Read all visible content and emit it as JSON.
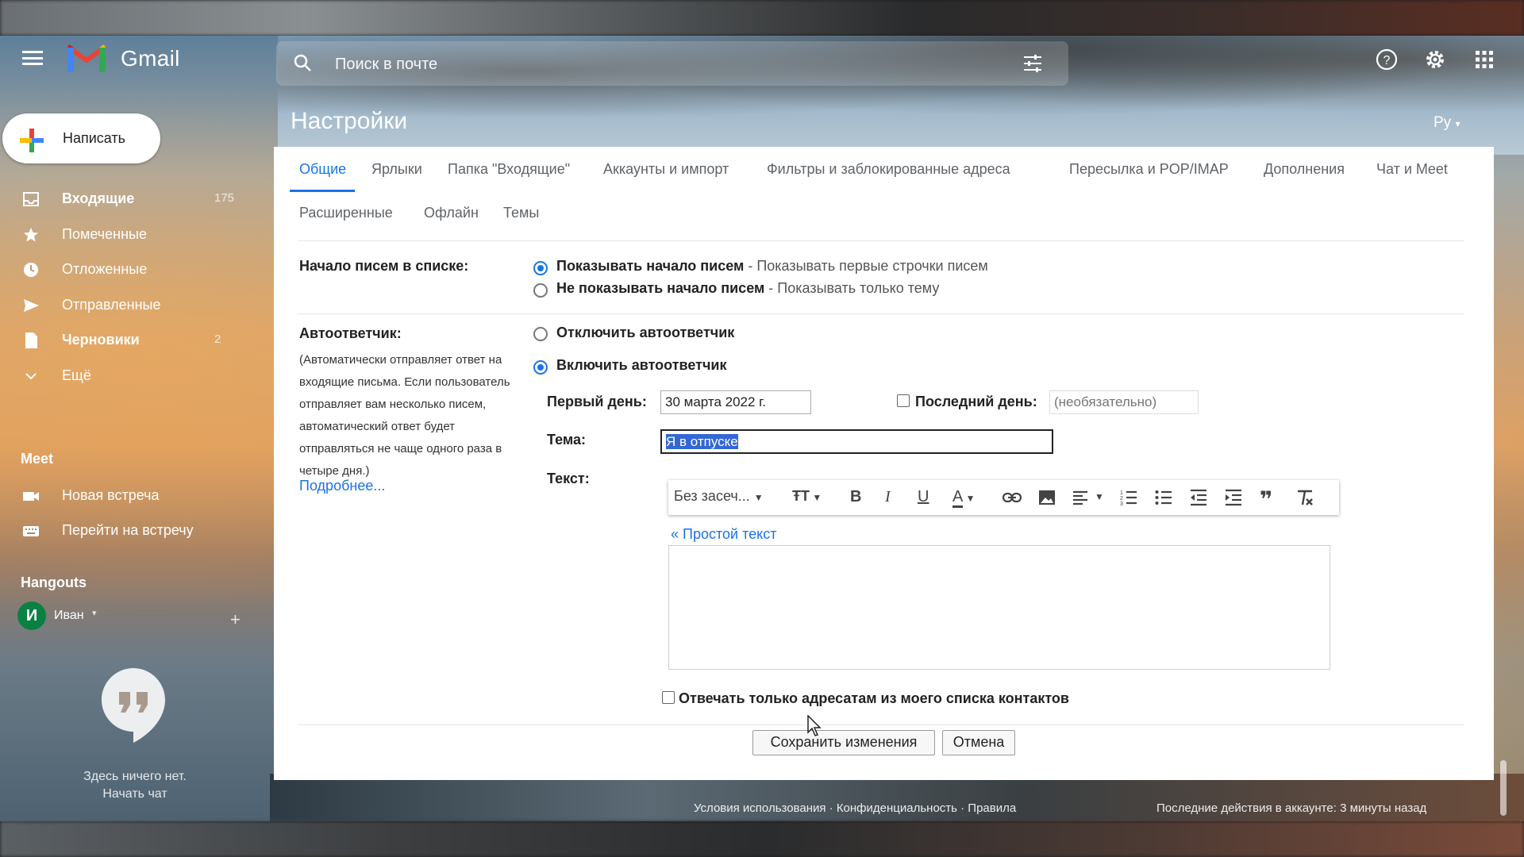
{
  "app": {
    "name": "Gmail"
  },
  "search": {
    "placeholder": "Поиск в почте"
  },
  "header": {
    "lang": "Ру"
  },
  "compose": {
    "label": "Написать"
  },
  "sidebar": {
    "items": [
      {
        "label": "Входящие",
        "count": "175",
        "icon": "inbox-icon"
      },
      {
        "label": "Помеченные",
        "count": "",
        "icon": "star-icon"
      },
      {
        "label": "Отложенные",
        "count": "",
        "icon": "clock-icon"
      },
      {
        "label": "Отправленные",
        "count": "",
        "icon": "send-icon"
      },
      {
        "label": "Черновики",
        "count": "2",
        "icon": "draft-icon"
      },
      {
        "label": "Ещё",
        "count": "",
        "icon": "chevron-down-icon"
      }
    ],
    "meet": {
      "title": "Meet",
      "items": [
        {
          "label": "Новая встреча",
          "icon": "video-icon"
        },
        {
          "label": "Перейти на встречу",
          "icon": "keyboard-icon"
        }
      ]
    },
    "hangouts": {
      "title": "Hangouts",
      "user_initial": "И",
      "user_name": "Иван",
      "empty_line1": "Здесь ничего нет.",
      "empty_line2": "Начать чат"
    }
  },
  "settings": {
    "title": "Настройки",
    "tabs": [
      "Общие",
      "Ярлыки",
      "Папка \"Входящие\"",
      "Аккаунты и импорт",
      "Фильтры и заблокированные адреса",
      "Пересылка и POP/IMAP",
      "Дополнения",
      "Чат и Meet"
    ],
    "tabs2": [
      "Расширенные",
      "Офлайн",
      "Темы"
    ],
    "snippets": {
      "label": "Начало писем в списке:",
      "opt1_bold": "Показывать начало писем",
      "opt1_desc": " - Показывать первые строчки писем",
      "opt2_bold": "Не показывать начало писем",
      "opt2_desc": " - Показывать только тему"
    },
    "vacation": {
      "label": "Автоответчик:",
      "note": "(Автоматически отправляет ответ на входящие письма. Если пользователь отправляет вам несколько писем, автоматический ответ будет отправляться не чаще одного раза в четыре дня.)",
      "more_link": "Подробнее...",
      "off_label": "Отключить автоответчик",
      "on_label": "Включить автоответчик",
      "first_day_label": "Первый день:",
      "first_day_value": "30 марта 2022 г.",
      "last_day_label": "Последний день:",
      "last_day_placeholder": "(необязательно)",
      "subject_label": "Тема:",
      "subject_value": "Я в отпуске",
      "text_label": "Текст:",
      "font_select": "Без засеч...",
      "plain_text_link": "« Простой текст",
      "contacts_only": "Отвечать только адресатам из моего списка контактов"
    },
    "save_label": "Сохранить изменения",
    "cancel_label": "Отмена"
  },
  "footer": {
    "terms": "Условия использования · Конфиденциальность · Правила",
    "activity": "Последние действия в аккаунте: 3 минуты назад"
  },
  "colors": {
    "accent": "#1a73e8",
    "selection": "#3367d6"
  }
}
